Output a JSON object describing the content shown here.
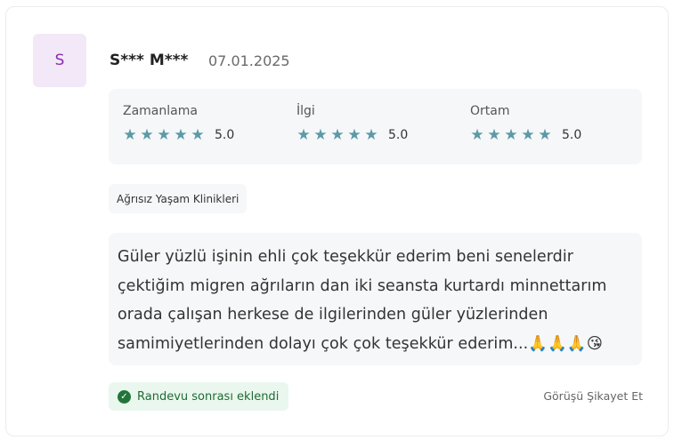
{
  "review": {
    "avatar_letter": "S",
    "author": "S*** M***",
    "date": "07.01.2025",
    "ratings": [
      {
        "label": "Zamanlama",
        "value": 5,
        "score": "5.0"
      },
      {
        "label": "İlgi",
        "value": 5,
        "score": "5.0"
      },
      {
        "label": "Ortam",
        "value": 5,
        "score": "5.0"
      }
    ],
    "star_max": 5,
    "star_color": "#5b9aa6",
    "clinic": "Ağrısız Yaşam Klinikleri",
    "comment": "Güler yüzlü işinin ehli çok teşekkür ederim beni senelerdir çektiğim migren ağrıların dan iki seansta kurtardı minnettarım orada çalışan herkese de ilgilerinden güler yüzlerinden samimiyetlerinden dolayı çok çok teşekkür ederim...🙏🙏🙏😘",
    "badge": {
      "text": "Randevu sonrası eklendi",
      "icon": "check-circle-icon",
      "color": "#22753a"
    },
    "report_label": "Görüşü Şikayet Et"
  }
}
